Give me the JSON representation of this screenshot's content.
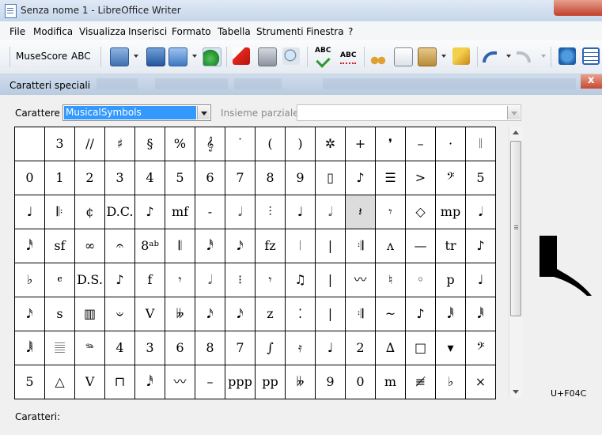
{
  "window": {
    "title": "Senza nome 1 - LibreOffice Writer"
  },
  "menu": [
    "File",
    "Modifica",
    "Visualizza",
    "Inserisci",
    "Formato",
    "Tabella",
    "Strumenti",
    "Finestra",
    "?"
  ],
  "toolbar": {
    "musescore_label": "MuseScore",
    "abc_label": "ABC",
    "spell_label": "ABC",
    "autospell_label": "ABC"
  },
  "dialog": {
    "title": "Caratteri speciali",
    "font_label": "Carattere",
    "font_value": "MusicalSymbols",
    "subset_label": "Insieme parziale",
    "subset_value": "",
    "chars_label": "Caratteri:",
    "chars_value": "",
    "selected_code": "U+F04C"
  },
  "char_grid": [
    [
      "",
      "3",
      "//",
      "♯",
      "§",
      "%",
      "𝄞",
      "˙",
      "(",
      ")",
      "✲",
      "+",
      "❜",
      "–",
      "·",
      "𝄁"
    ],
    [
      "0",
      "1",
      "2",
      "3",
      "4",
      "5",
      "6",
      "7",
      "8",
      "9",
      "▯",
      "♪",
      "☰",
      ">",
      "𝄢",
      "5"
    ],
    [
      "♩",
      "𝄆",
      "¢",
      "D.C.",
      "♪",
      "mf",
      "-",
      "𝅗𝅥",
      "⫶",
      "♩",
      "𝅗𝅥",
      "𝄽",
      "𝄾",
      "◇",
      "mp",
      "𝅘𝅥"
    ],
    [
      "𝅘𝅥𝅰",
      "sf",
      "∞",
      "𝄐",
      "8ᵃᵇ",
      "𝄃",
      "𝅘𝅥𝅰",
      "𝅘𝅥𝅯",
      "fz",
      "𝄀",
      "|",
      "𝄇",
      "ʌ",
      "—",
      "tr",
      "♪"
    ],
    [
      "♭",
      "𝄴",
      "D.S.",
      "♪",
      "f",
      "𝄾",
      "𝅗𝅥",
      "⁝",
      "𝄾",
      "♫",
      "|",
      "〰",
      "♮",
      "◦",
      "p",
      "♩"
    ],
    [
      "𝅘𝅥𝅯",
      "s",
      "▥",
      "𝄑",
      "V",
      "𝄫",
      "𝅘𝅥𝅯",
      "𝅘𝅥𝅯",
      "z",
      "⁚",
      "|",
      "𝄇",
      "~",
      "♪",
      "𝅘𝅥𝅱",
      "𝅘𝅥𝅱"
    ],
    [
      "𝅘𝅥𝅲",
      "𝄚",
      "𝆮",
      "4",
      "3",
      "6",
      "8",
      "7",
      "∫",
      "𝄿",
      "♩",
      "2",
      "∆",
      "□",
      "▾",
      "𝄢"
    ],
    [
      "5",
      "△",
      "V",
      "⊓",
      "𝅘𝅥𝅰",
      "〰",
      "–",
      "ppp",
      "pp",
      "𝄫",
      "9",
      "0",
      "m",
      "≢",
      "♭",
      "×"
    ]
  ],
  "selected_cell": [
    2,
    11
  ]
}
